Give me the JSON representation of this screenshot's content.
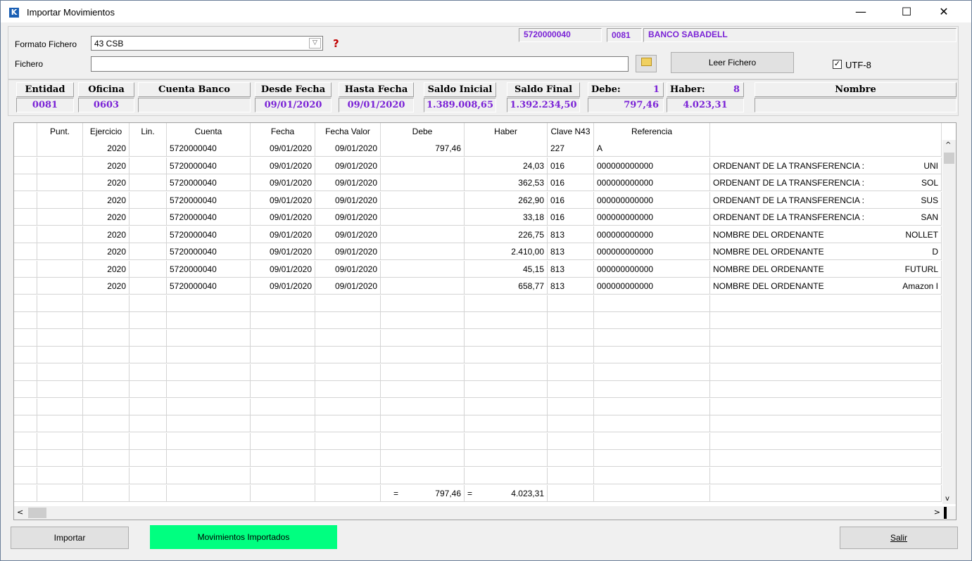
{
  "window": {
    "title": "Importar Movimientos",
    "minimize": "—",
    "maximize": "☐",
    "close": "✕"
  },
  "form": {
    "formato_label": "Formato Fichero",
    "formato_value": "43 CSB",
    "fichero_label": "Fichero",
    "fichero_value": "",
    "account_code": "5720000040",
    "bank_code": "0081",
    "bank_name": "BANCO SABADELL",
    "leer_button": "Leer Fichero",
    "utf8_label": "UTF-8",
    "utf8_checked": true
  },
  "summary": {
    "entidad_label": "Entidad",
    "entidad": "0081",
    "oficina_label": "Oficina",
    "oficina": "0603",
    "cuenta_label": "Cuenta Banco",
    "cuenta": "",
    "desde_label": "Desde Fecha",
    "desde": "09/01/2020",
    "hasta_label": "Hasta Fecha",
    "hasta": "09/01/2020",
    "saldo_inicial_label": "Saldo Inicial",
    "saldo_inicial": "1.389.008,65",
    "saldo_final_label": "Saldo Final",
    "saldo_final": "1.392.234,50",
    "debe_label": "Debe:",
    "debe_count": "1",
    "debe_total": "797,46",
    "haber_label": "Haber:",
    "haber_count": "8",
    "haber_total": "4.023,31",
    "nombre_label": "Nombre",
    "nombre": ""
  },
  "grid": {
    "columns": [
      "Punt.",
      "Ejercicio",
      "Lin.",
      "Cuenta",
      "Fecha",
      "Fecha Valor",
      "Debe",
      "Haber",
      "Clave N43",
      "Referencia",
      ""
    ],
    "rows": [
      {
        "ejercicio": "2020",
        "cuenta": "5720000040",
        "fecha": "09/01/2020",
        "valor": "09/01/2020",
        "debe": "797,46",
        "haber": "",
        "clave": "227",
        "ref": "A",
        "concepto": "",
        "extra": ""
      },
      {
        "ejercicio": "2020",
        "cuenta": "5720000040",
        "fecha": "09/01/2020",
        "valor": "09/01/2020",
        "debe": "",
        "haber": "24,03",
        "clave": "016",
        "ref": "000000000000",
        "concepto": "ORDENANT DE LA TRANSFERENCIA :",
        "extra": "UNI"
      },
      {
        "ejercicio": "2020",
        "cuenta": "5720000040",
        "fecha": "09/01/2020",
        "valor": "09/01/2020",
        "debe": "",
        "haber": "362,53",
        "clave": "016",
        "ref": "000000000000",
        "concepto": "ORDENANT DE LA TRANSFERENCIA :",
        "extra": "SOL"
      },
      {
        "ejercicio": "2020",
        "cuenta": "5720000040",
        "fecha": "09/01/2020",
        "valor": "09/01/2020",
        "debe": "",
        "haber": "262,90",
        "clave": "016",
        "ref": "000000000000",
        "concepto": "ORDENANT DE LA TRANSFERENCIA :",
        "extra": "SUS"
      },
      {
        "ejercicio": "2020",
        "cuenta": "5720000040",
        "fecha": "09/01/2020",
        "valor": "09/01/2020",
        "debe": "",
        "haber": "33,18",
        "clave": "016",
        "ref": "000000000000",
        "concepto": "ORDENANT DE LA TRANSFERENCIA :",
        "extra": "SAN"
      },
      {
        "ejercicio": "2020",
        "cuenta": "5720000040",
        "fecha": "09/01/2020",
        "valor": "09/01/2020",
        "debe": "",
        "haber": "226,75",
        "clave": "813",
        "ref": "000000000000",
        "concepto": "NOMBRE DEL ORDENANTE",
        "extra": "NOLLET"
      },
      {
        "ejercicio": "2020",
        "cuenta": "5720000040",
        "fecha": "09/01/2020",
        "valor": "09/01/2020",
        "debe": "",
        "haber": "2.410,00",
        "clave": "813",
        "ref": "000000000000",
        "concepto": "NOMBRE DEL ORDENANTE",
        "extra": "D"
      },
      {
        "ejercicio": "2020",
        "cuenta": "5720000040",
        "fecha": "09/01/2020",
        "valor": "09/01/2020",
        "debe": "",
        "haber": "45,15",
        "clave": "813",
        "ref": "000000000000",
        "concepto": "NOMBRE DEL ORDENANTE",
        "extra": "FUTURL"
      },
      {
        "ejercicio": "2020",
        "cuenta": "5720000040",
        "fecha": "09/01/2020",
        "valor": "09/01/2020",
        "debe": "",
        "haber": "658,77",
        "clave": "813",
        "ref": "000000000000",
        "concepto": "NOMBRE DEL ORDENANTE",
        "extra": "Amazon I"
      }
    ],
    "totals": {
      "eq1": "=",
      "debe": "797,46",
      "eq2": "=",
      "haber": "4.023,31"
    }
  },
  "footer": {
    "importar": "Importar",
    "status": "Movimientos Importados",
    "salir": "Salir"
  },
  "colors": {
    "accent_text": "#7a22d6",
    "status_bg": "#00ff80"
  }
}
